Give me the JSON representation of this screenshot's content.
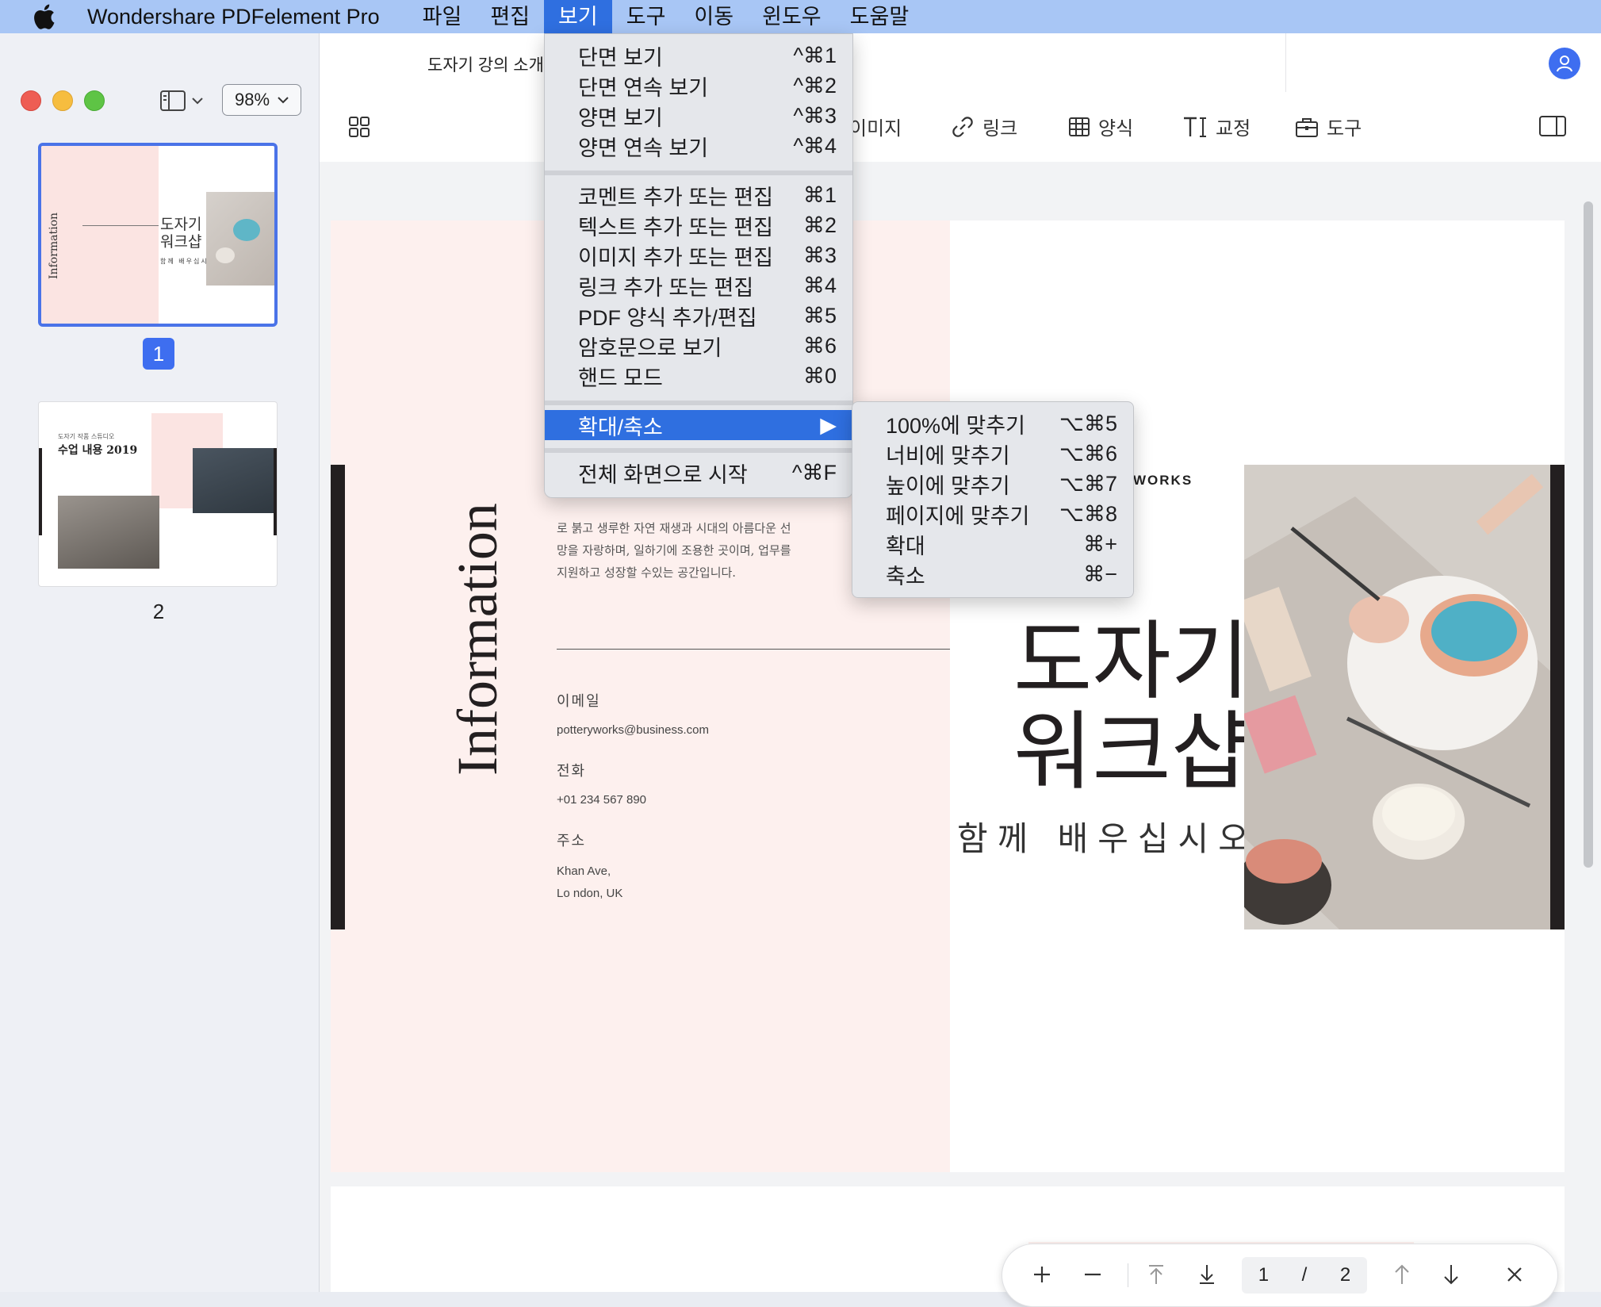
{
  "menubar": {
    "app_name": "Wondershare PDFelement Pro",
    "menus": [
      "파일",
      "편집",
      "보기",
      "도구",
      "이동",
      "윈도우",
      "도움말"
    ],
    "active_menu": "보기"
  },
  "sidebar": {
    "zoom": "98%",
    "pages": [
      {
        "number": "1",
        "selected": true,
        "thumb_title": "도자기\n워크샵",
        "thumb_subtitle": "함께 배우십시오",
        "thumb_info": "Information"
      },
      {
        "number": "2",
        "selected": false,
        "thumb_title": "수업 내용 2019",
        "thumb_pre": "도자기 작품 스튜디오"
      }
    ]
  },
  "tabs": {
    "document_title": "도자기 강의 소개"
  },
  "toolbar": {
    "items": [
      "이미지",
      "링크",
      "양식",
      "교정",
      "도구"
    ]
  },
  "document": {
    "info_vertical": "Information",
    "paragraph_lines": [
      "로 붉고 생루한 자연 재생과 시대의 아름다운 선",
      "망을 자랑하며, 일하기에 조용한 곳이며, 업무를",
      "지원하고 성장할 수있는 공간입니다."
    ],
    "email_label": "이메일",
    "email_value": "potteryworks@business.com",
    "phone_label": "전화",
    "phone_value": "+01 234 567 890",
    "address_label": "주소",
    "address_line1": "Khan Ave,",
    "address_line2": "Lo ndon, UK",
    "brand_partial": "WORKS",
    "title_line1": "도자기",
    "title_line2": "워크샵",
    "subtitle": "함께 배우십시오"
  },
  "bottom_nav": {
    "current_page": "1",
    "separator": "/",
    "total_pages": "2"
  },
  "view_menu": {
    "items": [
      {
        "label": "단면 보기",
        "shortcut": "^⌘1"
      },
      {
        "label": "단면 연속 보기",
        "shortcut": "^⌘2"
      },
      {
        "label": "양면 보기",
        "shortcut": "^⌘3"
      },
      {
        "label": "양면 연속 보기",
        "shortcut": "^⌘4"
      },
      {
        "label": "코멘트 추가 또는 편집",
        "shortcut": "⌘1"
      },
      {
        "label": "텍스트 추가 또는 편집",
        "shortcut": "⌘2"
      },
      {
        "label": "이미지 추가 또는 편집",
        "shortcut": "⌘3"
      },
      {
        "label": "링크 추가 또는 편집",
        "shortcut": "⌘4"
      },
      {
        "label": "PDF 양식 추가/편집",
        "shortcut": "⌘5"
      },
      {
        "label": "암호문으로 보기",
        "shortcut": "⌘6"
      },
      {
        "label": "핸드 모드",
        "shortcut": "⌘0"
      },
      {
        "label": "확대/축소",
        "shortcut": "▶"
      },
      {
        "label": "전체 화면으로 시작",
        "shortcut": "^⌘F"
      }
    ]
  },
  "zoom_submenu": {
    "items": [
      {
        "label": "100%에 맞추기",
        "shortcut": "⌥⌘5"
      },
      {
        "label": "너비에 맞추기",
        "shortcut": "⌥⌘6"
      },
      {
        "label": "높이에 맞추기",
        "shortcut": "⌥⌘7"
      },
      {
        "label": "페이지에 맞추기",
        "shortcut": "⌥⌘8"
      },
      {
        "label": "확대",
        "shortcut": "⌘+"
      },
      {
        "label": "축소",
        "shortcut": "⌘−"
      }
    ]
  },
  "colors": {
    "accent": "#2f6fe0",
    "menubar": "#a8c6f5",
    "page_pink": "#fdf0ee"
  }
}
